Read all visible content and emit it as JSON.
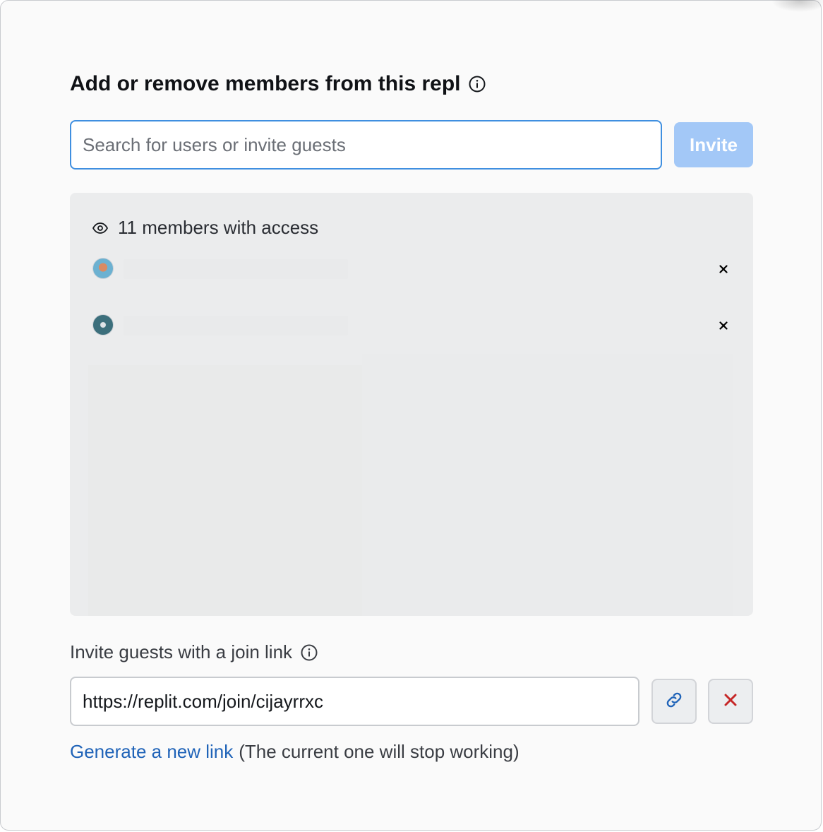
{
  "dialog": {
    "title": "Add or remove members from this repl"
  },
  "search": {
    "placeholder": "Search for users or invite guests",
    "value": ""
  },
  "invite_button": {
    "label": "Invite"
  },
  "members": {
    "summary": "11 members with access",
    "rows": [
      {
        "avatar": "avatar-image",
        "name": ""
      },
      {
        "avatar": "avatar-image",
        "name": ""
      }
    ]
  },
  "join_link": {
    "label": "Invite guests with a join link",
    "url": "https://replit.com/join/cijayrrxc"
  },
  "footer": {
    "generate_label": "Generate a new link",
    "note": "(The current one will stop working)"
  },
  "colors": {
    "accent": "#3f8fe0",
    "invite_disabled": "#a3c8f7",
    "link": "#1f63b8",
    "danger": "#c62828"
  }
}
